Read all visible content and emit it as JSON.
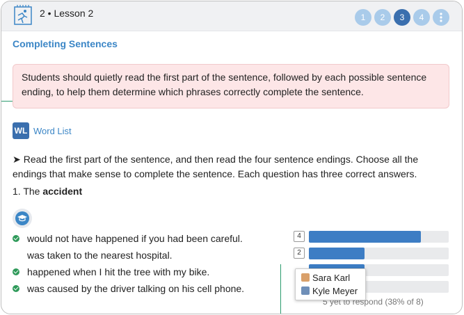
{
  "header": {
    "breadcrumb": "2 • Lesson 2",
    "lesson_icon": "lesson-runner-icon",
    "steps": [
      "1",
      "2",
      "3",
      "4"
    ],
    "active_step": "3",
    "more_icon": "more-vertical-icon"
  },
  "section_title": "Completing Sentences",
  "teacher_note": "Students should quietly read the first part of the sentence, followed by each possible sentence ending, to help them determine which phrases correctly complete the sentence.",
  "word_list": {
    "badge": "WL",
    "label": "Word List"
  },
  "instruction": "Read the first part of the sentence, and then read the four sentence endings. Choose all the endings that make sense to complete the sentence. Each question has three correct answers.",
  "question": {
    "number": "1. The",
    "word": "accident"
  },
  "answers": [
    {
      "text": "would not have happened if you had been careful.",
      "correct": true
    },
    {
      "text": "was taken to the nearest hospital.",
      "correct": false
    },
    {
      "text": "happened when I hit the tree with my bike.",
      "correct": true
    },
    {
      "text": "was caused by the driver talking on his cell phone.",
      "correct": true
    }
  ],
  "responses": [
    {
      "count": "4",
      "fraction": 0.8
    },
    {
      "count": "2",
      "fraction": 0.4
    },
    {
      "count": "",
      "fraction": 0.4
    },
    {
      "count": "",
      "fraction": 0.0
    }
  ],
  "tooltip": {
    "names": [
      "Sara Karl",
      "Kyle Meyer"
    ]
  },
  "respond_text": "5 yet to respond (38% of 8)",
  "colors": {
    "accent": "#3b86c6",
    "active_step": "#3a6fae",
    "step": "#a9cbea",
    "bar": "#3d7dc4",
    "note_bg": "#fde6e7",
    "check": "#2f9a5a"
  }
}
